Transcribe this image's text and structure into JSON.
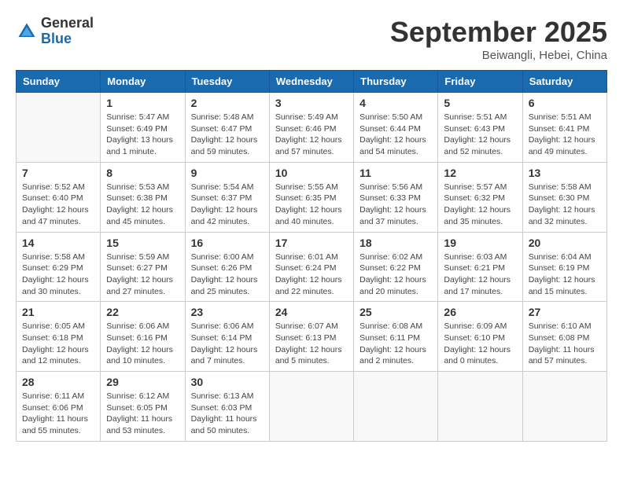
{
  "header": {
    "logo_general": "General",
    "logo_blue": "Blue",
    "month": "September 2025",
    "location": "Beiwangli, Hebei, China"
  },
  "weekdays": [
    "Sunday",
    "Monday",
    "Tuesday",
    "Wednesday",
    "Thursday",
    "Friday",
    "Saturday"
  ],
  "weeks": [
    [
      {
        "day": "",
        "info": ""
      },
      {
        "day": "1",
        "info": "Sunrise: 5:47 AM\nSunset: 6:49 PM\nDaylight: 13 hours\nand 1 minute."
      },
      {
        "day": "2",
        "info": "Sunrise: 5:48 AM\nSunset: 6:47 PM\nDaylight: 12 hours\nand 59 minutes."
      },
      {
        "day": "3",
        "info": "Sunrise: 5:49 AM\nSunset: 6:46 PM\nDaylight: 12 hours\nand 57 minutes."
      },
      {
        "day": "4",
        "info": "Sunrise: 5:50 AM\nSunset: 6:44 PM\nDaylight: 12 hours\nand 54 minutes."
      },
      {
        "day": "5",
        "info": "Sunrise: 5:51 AM\nSunset: 6:43 PM\nDaylight: 12 hours\nand 52 minutes."
      },
      {
        "day": "6",
        "info": "Sunrise: 5:51 AM\nSunset: 6:41 PM\nDaylight: 12 hours\nand 49 minutes."
      }
    ],
    [
      {
        "day": "7",
        "info": "Sunrise: 5:52 AM\nSunset: 6:40 PM\nDaylight: 12 hours\nand 47 minutes."
      },
      {
        "day": "8",
        "info": "Sunrise: 5:53 AM\nSunset: 6:38 PM\nDaylight: 12 hours\nand 45 minutes."
      },
      {
        "day": "9",
        "info": "Sunrise: 5:54 AM\nSunset: 6:37 PM\nDaylight: 12 hours\nand 42 minutes."
      },
      {
        "day": "10",
        "info": "Sunrise: 5:55 AM\nSunset: 6:35 PM\nDaylight: 12 hours\nand 40 minutes."
      },
      {
        "day": "11",
        "info": "Sunrise: 5:56 AM\nSunset: 6:33 PM\nDaylight: 12 hours\nand 37 minutes."
      },
      {
        "day": "12",
        "info": "Sunrise: 5:57 AM\nSunset: 6:32 PM\nDaylight: 12 hours\nand 35 minutes."
      },
      {
        "day": "13",
        "info": "Sunrise: 5:58 AM\nSunset: 6:30 PM\nDaylight: 12 hours\nand 32 minutes."
      }
    ],
    [
      {
        "day": "14",
        "info": "Sunrise: 5:58 AM\nSunset: 6:29 PM\nDaylight: 12 hours\nand 30 minutes."
      },
      {
        "day": "15",
        "info": "Sunrise: 5:59 AM\nSunset: 6:27 PM\nDaylight: 12 hours\nand 27 minutes."
      },
      {
        "day": "16",
        "info": "Sunrise: 6:00 AM\nSunset: 6:26 PM\nDaylight: 12 hours\nand 25 minutes."
      },
      {
        "day": "17",
        "info": "Sunrise: 6:01 AM\nSunset: 6:24 PM\nDaylight: 12 hours\nand 22 minutes."
      },
      {
        "day": "18",
        "info": "Sunrise: 6:02 AM\nSunset: 6:22 PM\nDaylight: 12 hours\nand 20 minutes."
      },
      {
        "day": "19",
        "info": "Sunrise: 6:03 AM\nSunset: 6:21 PM\nDaylight: 12 hours\nand 17 minutes."
      },
      {
        "day": "20",
        "info": "Sunrise: 6:04 AM\nSunset: 6:19 PM\nDaylight: 12 hours\nand 15 minutes."
      }
    ],
    [
      {
        "day": "21",
        "info": "Sunrise: 6:05 AM\nSunset: 6:18 PM\nDaylight: 12 hours\nand 12 minutes."
      },
      {
        "day": "22",
        "info": "Sunrise: 6:06 AM\nSunset: 6:16 PM\nDaylight: 12 hours\nand 10 minutes."
      },
      {
        "day": "23",
        "info": "Sunrise: 6:06 AM\nSunset: 6:14 PM\nDaylight: 12 hours\nand 7 minutes."
      },
      {
        "day": "24",
        "info": "Sunrise: 6:07 AM\nSunset: 6:13 PM\nDaylight: 12 hours\nand 5 minutes."
      },
      {
        "day": "25",
        "info": "Sunrise: 6:08 AM\nSunset: 6:11 PM\nDaylight: 12 hours\nand 2 minutes."
      },
      {
        "day": "26",
        "info": "Sunrise: 6:09 AM\nSunset: 6:10 PM\nDaylight: 12 hours\nand 0 minutes."
      },
      {
        "day": "27",
        "info": "Sunrise: 6:10 AM\nSunset: 6:08 PM\nDaylight: 11 hours\nand 57 minutes."
      }
    ],
    [
      {
        "day": "28",
        "info": "Sunrise: 6:11 AM\nSunset: 6:06 PM\nDaylight: 11 hours\nand 55 minutes."
      },
      {
        "day": "29",
        "info": "Sunrise: 6:12 AM\nSunset: 6:05 PM\nDaylight: 11 hours\nand 53 minutes."
      },
      {
        "day": "30",
        "info": "Sunrise: 6:13 AM\nSunset: 6:03 PM\nDaylight: 11 hours\nand 50 minutes."
      },
      {
        "day": "",
        "info": ""
      },
      {
        "day": "",
        "info": ""
      },
      {
        "day": "",
        "info": ""
      },
      {
        "day": "",
        "info": ""
      }
    ]
  ]
}
